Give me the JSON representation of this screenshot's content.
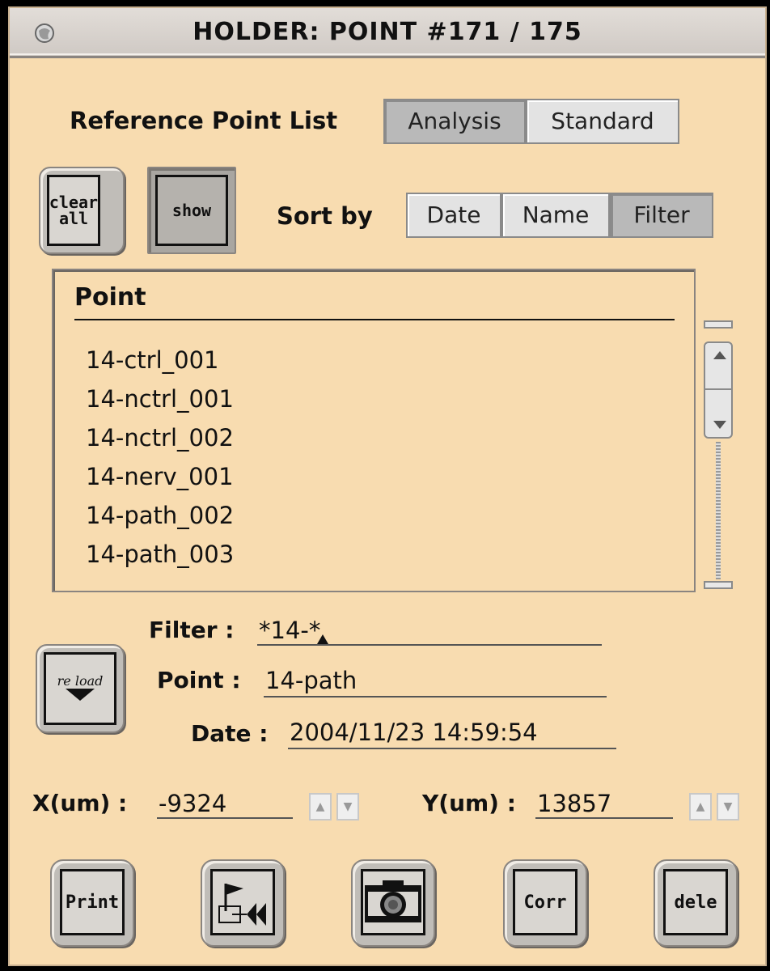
{
  "window": {
    "title": "HOLDER: POINT #171 / 175"
  },
  "reference": {
    "label": "Reference Point List",
    "options": [
      {
        "label": "Analysis",
        "selected": true
      },
      {
        "label": "Standard",
        "selected": false
      }
    ]
  },
  "buttons": {
    "clear_all": "clear all",
    "show": "show",
    "reload": "re load"
  },
  "sort": {
    "label": "Sort by",
    "options": [
      {
        "label": "Date",
        "selected": false
      },
      {
        "label": "Name",
        "selected": false
      },
      {
        "label": "Filter",
        "selected": true
      }
    ]
  },
  "list": {
    "header": "Point",
    "items": [
      "14-ctrl_001",
      "14-nctrl_001",
      "14-nctrl_002",
      "14-nerv_001",
      "14-path_002",
      "14-path_003"
    ]
  },
  "fields": {
    "filter_label": "Filter :",
    "filter_value": "*14-*",
    "point_label": "Point :",
    "point_value": "14-path",
    "date_label": "Date :",
    "date_value": "2004/11/23 14:59:54"
  },
  "coords": {
    "x_label": "X(um) :",
    "x_value": "-9324",
    "y_label": "Y(um) :",
    "y_value": "13857"
  },
  "bottom_buttons": {
    "print": "Print",
    "corr": "Corr",
    "dele": "dele"
  },
  "icons": {
    "window_menu": "globe-icon",
    "restore": "flag-rewind-icon",
    "camera": "camera-icon",
    "reload": "reload-down-arrow-icon"
  }
}
